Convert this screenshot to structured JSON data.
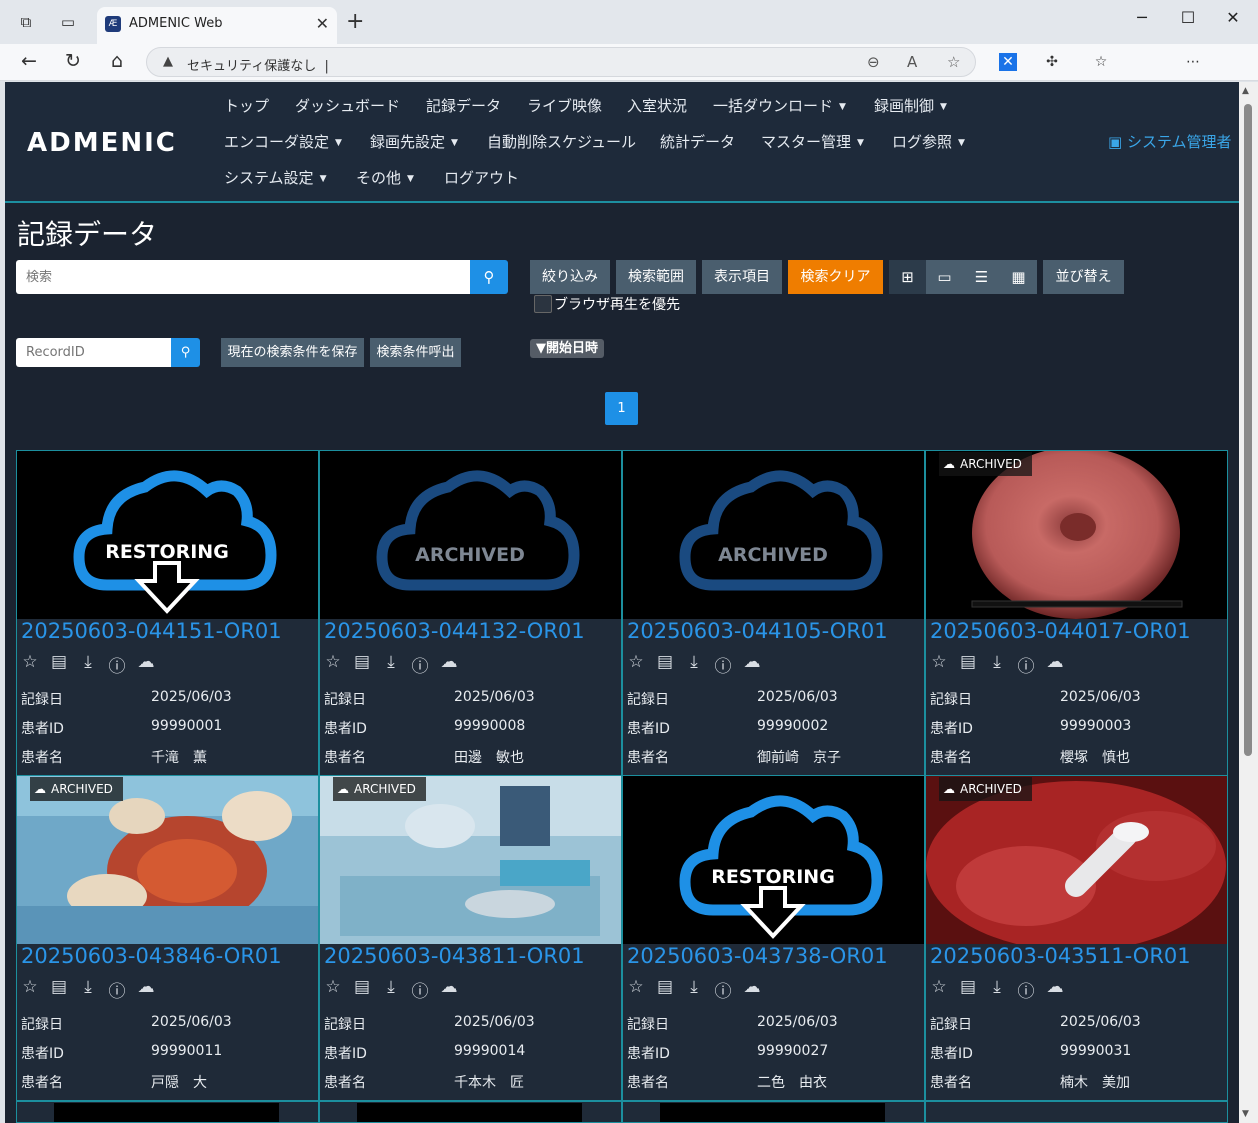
{
  "browser": {
    "tab_title": "ADMENIC Web",
    "address_warning": "セキュリティ保護なし",
    "address_text": "|"
  },
  "header": {
    "logo": "ADMENIC",
    "menu_row1": [
      "トップ",
      "ダッシュボード",
      "記録データ",
      "ライブ映像",
      "入室状況",
      "一括ダウンロード",
      "録画制御"
    ],
    "menu_row2": [
      "エンコーダ設定",
      "録画先設定",
      "自動削除スケジュール",
      "統計データ",
      "マスター管理",
      "ログ参照"
    ],
    "menu_row3": [
      "システム設定",
      "その他",
      "ログアウト"
    ],
    "admin": "システム管理者"
  },
  "page": {
    "title": "記録データ",
    "search_placeholder": "検索",
    "btn_filter": "絞り込み",
    "btn_range": "検索範囲",
    "btn_display": "表示項目",
    "btn_clear": "検索クリア",
    "btn_sort": "並び替え",
    "checkbox_label": "ブラウザ再生を優先",
    "recordid_placeholder": "RecordID",
    "btn_save_cond": "現在の検索条件を保存",
    "btn_load_cond": "検索条件呼出",
    "sort_key": "▼開始日時",
    "page_number": "1"
  },
  "labels": {
    "date": "記録日",
    "patient_id": "患者ID",
    "patient_name": "患者名",
    "restoring": "RESTORING",
    "archived": "ARCHIVED"
  },
  "records": [
    {
      "id": "20250603-044151-OR01",
      "date": "2025/06/03",
      "patient_id": "99990001",
      "patient_name": "千滝　薫",
      "status": "restoring"
    },
    {
      "id": "20250603-044132-OR01",
      "date": "2025/06/03",
      "patient_id": "99990008",
      "patient_name": "田邊　敏也",
      "status": "archived-placeholder"
    },
    {
      "id": "20250603-044105-OR01",
      "date": "2025/06/03",
      "patient_id": "99990002",
      "patient_name": "御前崎　京子",
      "status": "archived-placeholder"
    },
    {
      "id": "20250603-044017-OR01",
      "date": "2025/06/03",
      "patient_id": "99990003",
      "patient_name": "櫻塚　慎也",
      "status": "archived-endoscopy"
    },
    {
      "id": "20250603-043846-OR01",
      "date": "2025/06/03",
      "patient_id": "99990011",
      "patient_name": "戸隠　大",
      "status": "archived-surgery"
    },
    {
      "id": "20250603-043811-OR01",
      "date": "2025/06/03",
      "patient_id": "99990014",
      "patient_name": "千本木　匠",
      "status": "archived-instruments"
    },
    {
      "id": "20250603-043738-OR01",
      "date": "2025/06/03",
      "patient_id": "99990027",
      "patient_name": "二色　由衣",
      "status": "restoring"
    },
    {
      "id": "20250603-043511-OR01",
      "date": "2025/06/03",
      "patient_id": "99990031",
      "patient_name": "楠木　美加",
      "status": "archived-brain"
    }
  ],
  "colors": {
    "accent": "#1e90e6",
    "clear_button": "#ef7d00",
    "background": "#1b2330",
    "card_border": "#1c8f9e"
  }
}
